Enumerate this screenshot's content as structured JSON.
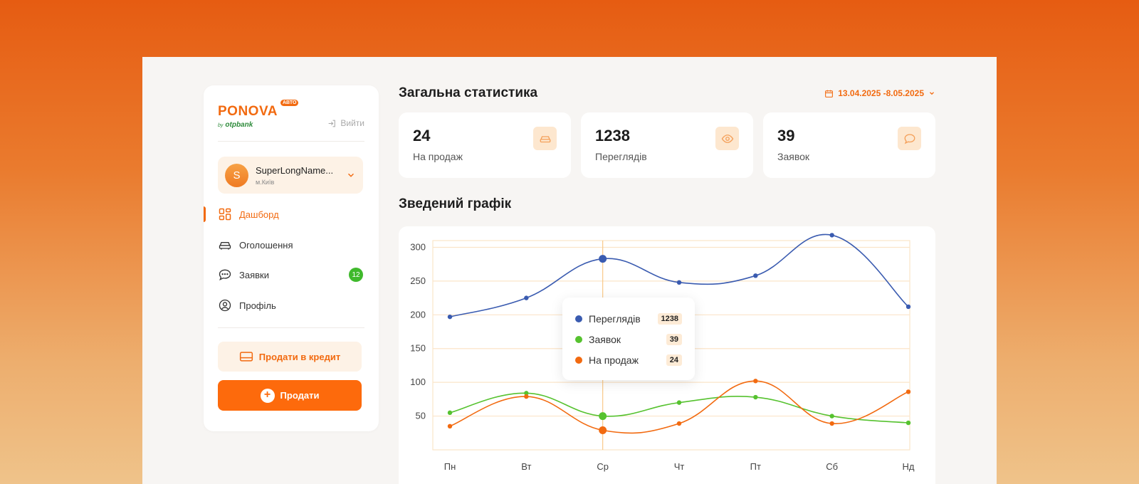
{
  "brand": {
    "name": "PONOVA",
    "badge": "АВТО",
    "by": "by",
    "partner": "otpbank",
    "accent": "#f26a10",
    "partner_color": "#2e8b3b"
  },
  "sidebar": {
    "logout_label": "Вийти",
    "user": {
      "initial": "S",
      "name": "SuperLongName...",
      "city": "м.Київ"
    },
    "items": [
      {
        "label": "Дашборд",
        "icon": "dashboard-icon",
        "active": true
      },
      {
        "label": "Оголошення",
        "icon": "car-icon"
      },
      {
        "label": "Заявки",
        "icon": "chat-icon",
        "badge": "12"
      },
      {
        "label": "Профіль",
        "icon": "user-circle-icon"
      }
    ],
    "credit_button": "Продати в кредит",
    "sell_button": "Продати"
  },
  "header": {
    "title": "Загальна статистика",
    "date_range": "13.04.2025 -8.05.2025"
  },
  "stats": [
    {
      "value": "24",
      "label": "На продаж",
      "icon": "car-icon"
    },
    {
      "value": "1238",
      "label": "Переглядів",
      "icon": "eye-icon"
    },
    {
      "value": "39",
      "label": "Заявок",
      "icon": "chat-icon"
    }
  ],
  "chart_title": "Зведений графік",
  "tooltip": [
    {
      "label": "Переглядів",
      "value": "1238",
      "color": "#3a5bb0"
    },
    {
      "label": "Заявок",
      "value": "39",
      "color": "#56c22f"
    },
    {
      "label": "На продаж",
      "value": "24",
      "color": "#f26a10"
    }
  ],
  "chart_data": {
    "type": "line",
    "categories": [
      "Пн",
      "Вт",
      "Ср",
      "Чт",
      "Пт",
      "Сб",
      "Нд"
    ],
    "y_ticks": [
      300,
      250,
      200,
      150,
      100,
      50
    ],
    "ylim": [
      0,
      310
    ],
    "highlight_index": 2,
    "series": [
      {
        "name": "Переглядів",
        "color": "#3a5bb0",
        "values": [
          197,
          225,
          283,
          248,
          258,
          318,
          212
        ]
      },
      {
        "name": "Заявок",
        "color": "#56c22f",
        "values": [
          55,
          84,
          50,
          70,
          78,
          50,
          40
        ]
      },
      {
        "name": "На продаж",
        "color": "#f26a10",
        "values": [
          35,
          79,
          29,
          39,
          102,
          39,
          86
        ]
      }
    ],
    "grid": true
  }
}
